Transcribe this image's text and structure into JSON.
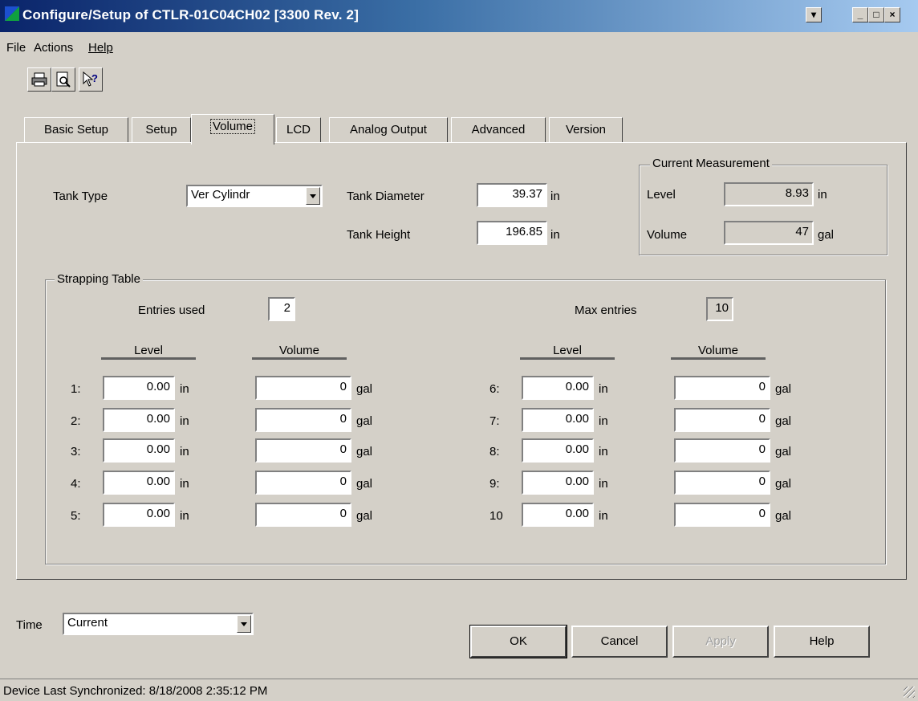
{
  "window": {
    "title": "Configure/Setup of CTLR-01C04CH02 [3300 Rev. 2]",
    "controls": {
      "scroll": "▾",
      "minimize": "_",
      "maximize": "□",
      "close": "×"
    }
  },
  "menu": {
    "file": "File",
    "actions": "Actions",
    "help": "Help"
  },
  "toolbar": {
    "print_icon": "printer-icon",
    "preview_icon": "print-preview-icon",
    "help_icon": "whats-this-help-icon"
  },
  "tabs": [
    {
      "label": "Basic Setup"
    },
    {
      "label": "Setup"
    },
    {
      "label": "Volume"
    },
    {
      "label": "LCD"
    },
    {
      "label": "Analog Output"
    },
    {
      "label": "Advanced"
    },
    {
      "label": "Version"
    }
  ],
  "tank": {
    "type_label": "Tank Type",
    "type_value": "Ver Cylindr",
    "diameter_label": "Tank Diameter",
    "diameter_value": "39.37",
    "diameter_unit": "in",
    "height_label": "Tank Height",
    "height_value": "196.85",
    "height_unit": "in"
  },
  "current_measurement": {
    "title": "Current Measurement",
    "level_label": "Level",
    "level_value": "8.93",
    "level_unit": "in",
    "volume_label": "Volume",
    "volume_value": "47",
    "volume_unit": "gal"
  },
  "strapping": {
    "title": "Strapping Table",
    "entries_used_label": "Entries used",
    "entries_used_value": "2",
    "max_entries_label": "Max entries",
    "max_entries_value": "10",
    "level_header": "Level",
    "volume_header": "Volume",
    "level_unit": "in",
    "volume_unit": "gal",
    "rows": [
      {
        "index": "1:",
        "level": "0.00",
        "volume": "0"
      },
      {
        "index": "2:",
        "level": "0.00",
        "volume": "0"
      },
      {
        "index": "3:",
        "level": "0.00",
        "volume": "0"
      },
      {
        "index": "4:",
        "level": "0.00",
        "volume": "0"
      },
      {
        "index": "5:",
        "level": "0.00",
        "volume": "0"
      },
      {
        "index": "6:",
        "level": "0.00",
        "volume": "0"
      },
      {
        "index": "7:",
        "level": "0.00",
        "volume": "0"
      },
      {
        "index": "8:",
        "level": "0.00",
        "volume": "0"
      },
      {
        "index": "9:",
        "level": "0.00",
        "volume": "0"
      },
      {
        "index": "10",
        "level": "0.00",
        "volume": "0"
      }
    ]
  },
  "time": {
    "label": "Time",
    "value": "Current"
  },
  "buttons": {
    "ok": "OK",
    "cancel": "Cancel",
    "apply": "Apply",
    "help": "Help"
  },
  "status": {
    "text": "Device Last Synchronized: 8/18/2008 2:35:12 PM"
  }
}
